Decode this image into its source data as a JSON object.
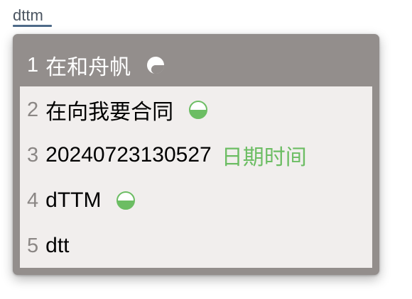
{
  "preedit": {
    "text": "dttm"
  },
  "candidates": [
    {
      "index": "1",
      "text": "在和舟帆",
      "comment": "",
      "icon": "yin-yang-icon",
      "highlighted": true
    },
    {
      "index": "2",
      "text": "在向我要合同",
      "comment": "",
      "icon": "yin-yang-icon",
      "highlighted": false
    },
    {
      "index": "3",
      "text": "20240723130527",
      "comment": "日期时间",
      "icon": "",
      "highlighted": false
    },
    {
      "index": "4",
      "text": "dTTM",
      "comment": "",
      "icon": "yin-yang-icon",
      "highlighted": false
    },
    {
      "index": "5",
      "text": "dtt",
      "comment": "",
      "icon": "",
      "highlighted": false
    }
  ],
  "colors": {
    "panel": "#938e8c",
    "list_background": "#f1eeed",
    "highlight_text": "#ffffff",
    "comment": "#6cbd63",
    "index": "#8b8785"
  }
}
